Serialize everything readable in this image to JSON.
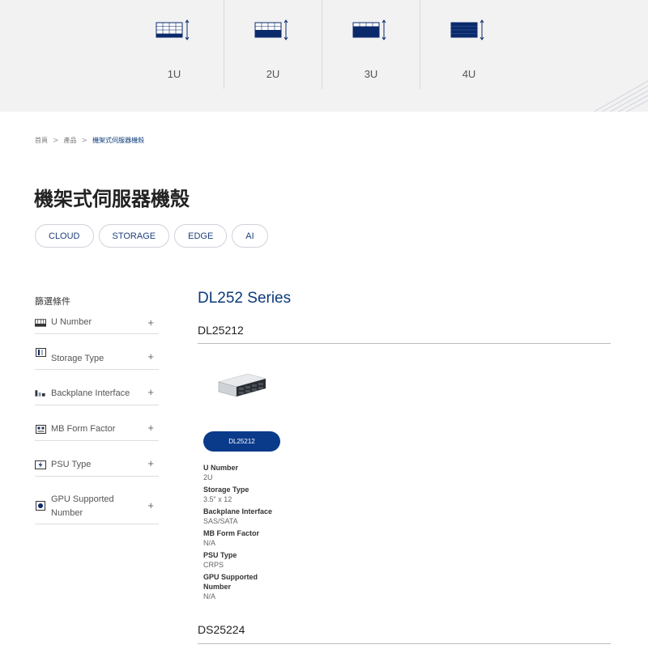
{
  "u_selector": {
    "items": [
      {
        "label": "1U",
        "filled_rows": 1
      },
      {
        "label": "2U",
        "filled_rows": 2
      },
      {
        "label": "3U",
        "filled_rows": 3
      },
      {
        "label": "4U",
        "filled_rows": 4
      }
    ]
  },
  "breadcrumb": {
    "home": "首頁",
    "products": "產品",
    "current": "機架式伺服器機殼"
  },
  "page_title": "機架式伺服器機殼",
  "category_pills": [
    "CLOUD",
    "STORAGE",
    "EDGE",
    "AI"
  ],
  "filters": {
    "heading": "篩選條件",
    "items": [
      {
        "label": "U Number",
        "icon": "rack-icon"
      },
      {
        "label": "Storage Type",
        "icon": "storage-icon"
      },
      {
        "label": "Backplane Interface",
        "icon": "backplane-icon"
      },
      {
        "label": "MB Form Factor",
        "icon": "motherboard-icon"
      },
      {
        "label": "PSU Type",
        "icon": "power-icon"
      },
      {
        "label": "GPU Supported Number",
        "icon": "gpu-icon"
      }
    ],
    "expand_symbol": "+"
  },
  "series": {
    "title": "DL252 Series",
    "products": [
      {
        "name": "DL25212",
        "button_label": "DL25212",
        "specs": [
          {
            "key": "U Number",
            "value": "2U"
          },
          {
            "key": "Storage Type",
            "value": "3.5\" x 12"
          },
          {
            "key": "Backplane Interface",
            "value": "SAS/SATA"
          },
          {
            "key": "MB Form Factor",
            "value": "N/A"
          },
          {
            "key": "PSU Type",
            "value": "CRPS"
          },
          {
            "key": "GPU Supported Number",
            "value": "N/A"
          }
        ]
      },
      {
        "name": "DS25224"
      }
    ]
  },
  "colors": {
    "brand_blue": "#0a3a8a",
    "band_bg": "#f2f2f3"
  }
}
